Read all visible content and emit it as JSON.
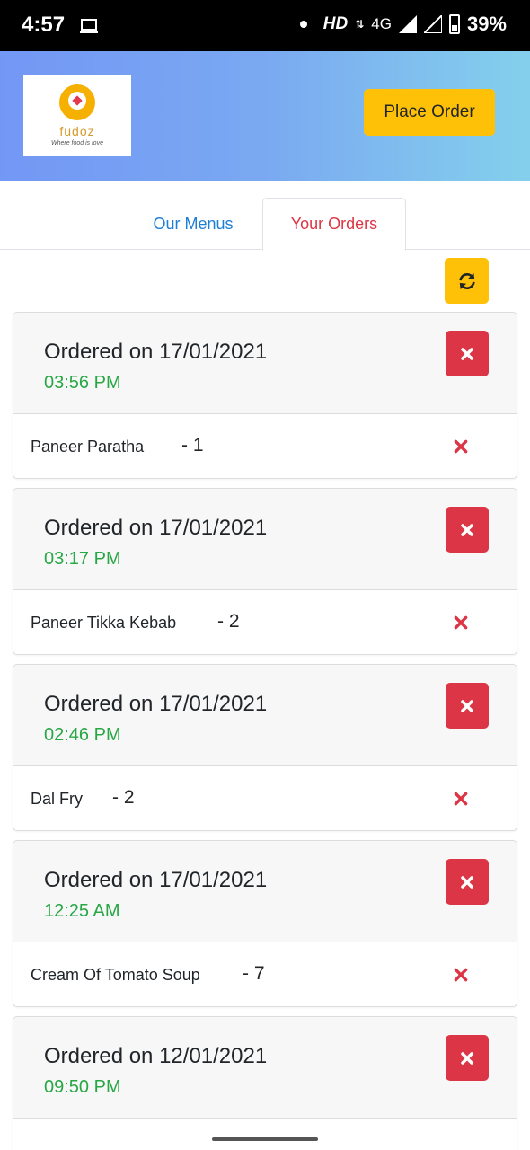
{
  "status_bar": {
    "time": "4:57",
    "network_hd": "HD",
    "network_type": "4G",
    "battery": "39%"
  },
  "header": {
    "logo_text": "fudoz",
    "logo_tagline": "Where food is love",
    "place_order_label": "Place Order"
  },
  "tabs": [
    {
      "label": "Our Menus",
      "active": false
    },
    {
      "label": "Your Orders",
      "active": true
    }
  ],
  "orders": [
    {
      "title": "Ordered on 17/01/2021",
      "time": "03:56 PM",
      "item": "Paneer Paratha",
      "qty": "- 1"
    },
    {
      "title": "Ordered on 17/01/2021",
      "time": "03:17 PM",
      "item": "Paneer Tikka Kebab",
      "qty": "- 2"
    },
    {
      "title": "Ordered on 17/01/2021",
      "time": "02:46 PM",
      "item": "Dal Fry",
      "qty": "- 2"
    },
    {
      "title": "Ordered on 17/01/2021",
      "time": "12:25 AM",
      "item": "Cream Of Tomato Soup",
      "qty": "- 7"
    },
    {
      "title": "Ordered on 12/01/2021",
      "time": "09:50 PM",
      "item": "",
      "qty": ""
    }
  ],
  "colors": {
    "accent_yellow": "#ffc107",
    "danger_red": "#dc3545",
    "success_green": "#28a745",
    "link_blue": "#1e7fd6"
  }
}
